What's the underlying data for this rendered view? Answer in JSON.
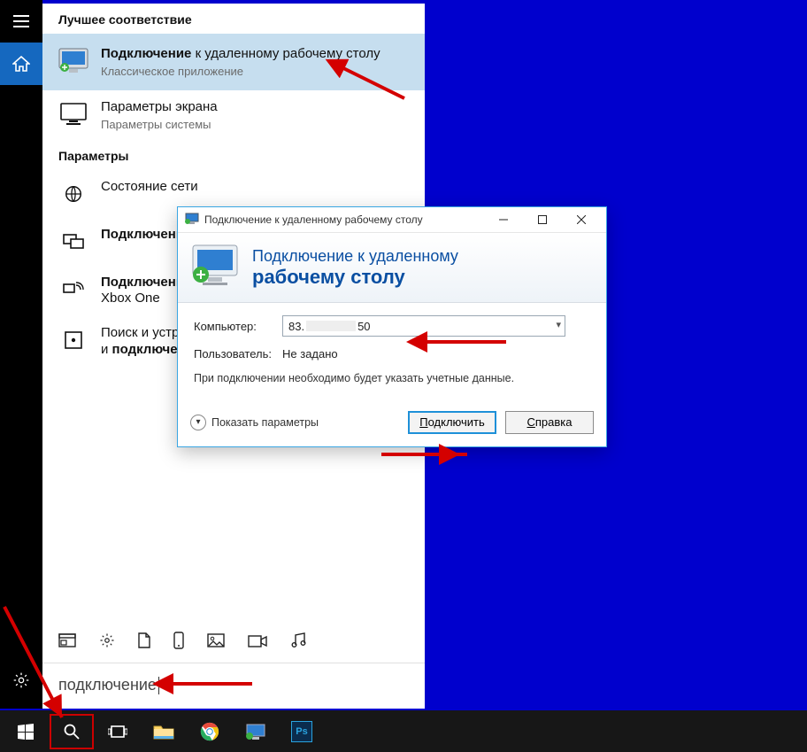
{
  "start": {
    "section_best": "Лучшее соответствие",
    "section_params": "Параметры",
    "best_match": {
      "title_bold": "Подключение",
      "title_rest": " к удаленному рабочему столу",
      "subtitle": "Классическое приложение"
    },
    "result_display": {
      "title": "Параметры экрана",
      "subtitle": "Параметры системы"
    },
    "params_items": [
      {
        "icon": "globe",
        "text": "Состояние сети"
      },
      {
        "icon": "connect",
        "text_bold": "Подключение"
      },
      {
        "icon": "stream",
        "text_prefix": "Подключение",
        "text_rest": " к Xbox One",
        "wrap_extra": "Xbox One"
      },
      {
        "icon": "search",
        "text_prefix": "Поиск и устранение",
        "text_rest2": "и ",
        "text_bold2": "подключени"
      }
    ],
    "search_query": "подключение"
  },
  "rdp": {
    "window_title": "Подключение к удаленному рабочему столу",
    "banner_line1": "Подключение к удаленному",
    "banner_line2": "рабочему столу",
    "label_computer": "Компьютер:",
    "computer_value_prefix": "83.",
    "computer_value_suffix": "50",
    "label_user": "Пользователь:",
    "user_value": "Не задано",
    "note": "При подключении необходимо будет указать учетные данные.",
    "show_options": "Показать параметры",
    "btn_connect": "одключить",
    "btn_connect_ul": "П",
    "btn_help": "правка",
    "btn_help_ul": "С"
  },
  "rail": {
    "hamburger": "hamburger-icon",
    "home": "home-icon",
    "settings": "settings-icon"
  },
  "categories": {
    "app": "app-icon",
    "settings": "settings-icon",
    "doc": "document-icon",
    "phone": "phone-icon",
    "image": "image-icon",
    "video": "video-icon",
    "music": "music-icon"
  },
  "taskbar": {
    "start": "start-icon",
    "search": "search-icon",
    "taskview": "task-view-icon",
    "explorer": "file-explorer-icon",
    "chrome": "chrome-icon",
    "rdp": "rdp-icon",
    "ps": "photoshop-icon"
  }
}
